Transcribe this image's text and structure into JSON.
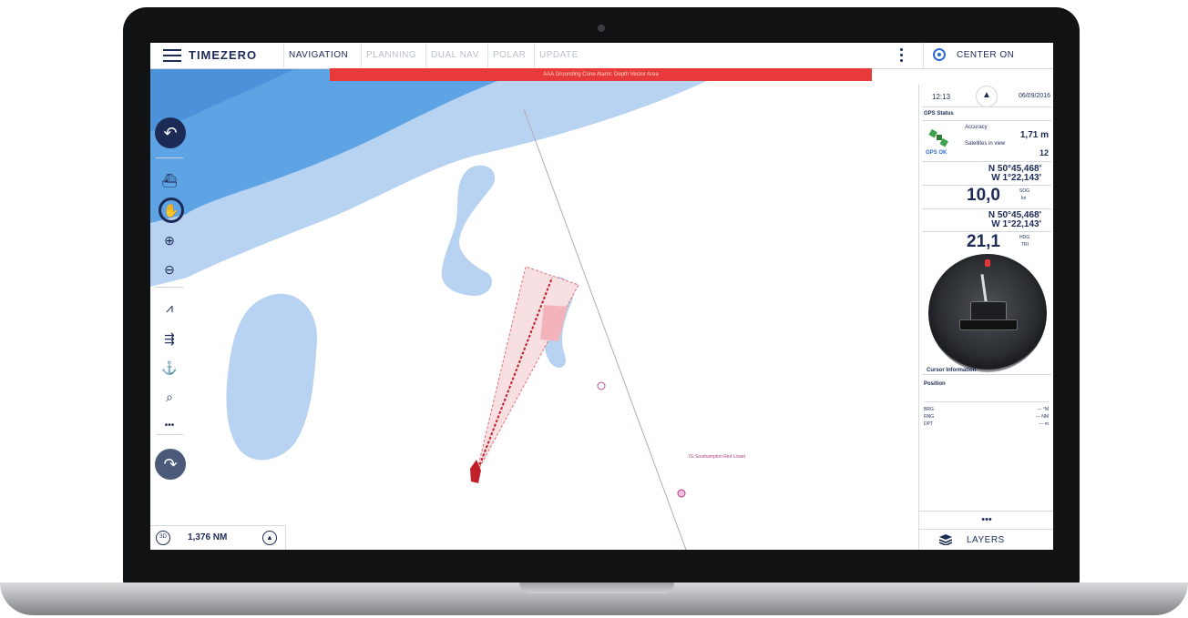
{
  "app": {
    "brand": "TIMEZERO"
  },
  "tabs": [
    {
      "label": "NAVIGATION"
    },
    {
      "label": "PLANNING"
    },
    {
      "label": "DUAL NAV"
    },
    {
      "label": "POLAR"
    },
    {
      "label": "UPDATE"
    }
  ],
  "header": {
    "center_on_label": "CENTER ON"
  },
  "alarm": {
    "text": "AAA Grounding Cone Alarm: Depth Vector Area"
  },
  "map": {
    "waypoint_label": "7G Southampton Red Lower"
  },
  "toolbar": {
    "more_label": "•••"
  },
  "status": {
    "scale": "1,376 NM",
    "view_mode": "3D"
  },
  "panel": {
    "time": "12:13",
    "date": "06/09/2016",
    "gps_title": "GPS Status",
    "gps_ok": "GPS OK",
    "accuracy_label": "Accuracy",
    "accuracy_value": "1,71 m",
    "satellites_label": "Satellites in view",
    "satellites_value": "12",
    "position1_lat": "N 50°45,468'",
    "position1_lon": "W 1°22,143'",
    "speed_value": "10,0",
    "speed_unit_top": "SOG",
    "speed_unit_bottom": "kn",
    "position2_lat": "N 50°45,468'",
    "position2_lon": "W 1°22,143'",
    "heading_value": "21,1",
    "heading_unit_top": "HDG",
    "heading_unit_bottom": "TRI",
    "cursor_title": "Cursor Information",
    "cursor_position_label": "Position",
    "cursor_rows": [
      {
        "label": "BRG",
        "value": "--- °M"
      },
      {
        "label": "RNG",
        "value": "--- NM"
      },
      {
        "label": "DPT",
        "value": "--- m"
      }
    ],
    "more_label": "•••",
    "layers_label": "LAYERS"
  },
  "colors": {
    "navy": "#1c2a56",
    "deep_water": "#5ea3e4",
    "shallow_water": "#b8d2f1",
    "alarm_red": "#e8393b",
    "accent_blue": "#2f6bd5"
  }
}
